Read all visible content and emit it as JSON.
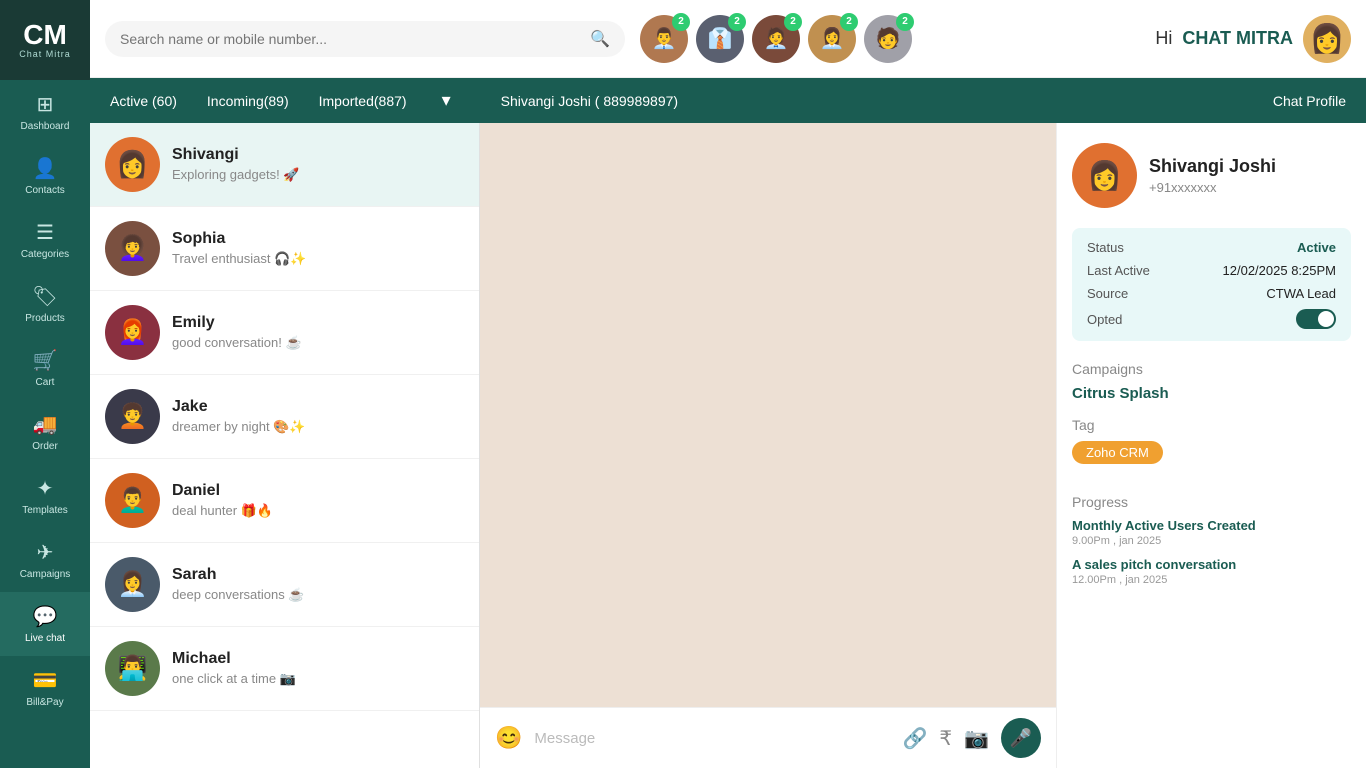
{
  "sidebar": {
    "logo": {
      "cm": "CM",
      "subtitle": "Chat Mitra"
    },
    "items": [
      {
        "id": "dashboard",
        "label": "Dashboard",
        "icon": "⊞"
      },
      {
        "id": "contacts",
        "label": "Contacts",
        "icon": "👤"
      },
      {
        "id": "categories",
        "label": "Categories",
        "icon": "≡"
      },
      {
        "id": "products",
        "label": "Products",
        "icon": "🏷"
      },
      {
        "id": "cart",
        "label": "Cart",
        "icon": "🛒"
      },
      {
        "id": "order",
        "label": "Order",
        "icon": "🚚"
      },
      {
        "id": "templates",
        "label": "Templates",
        "icon": "✦"
      },
      {
        "id": "campaigns",
        "label": "Campaigns",
        "icon": "✈"
      },
      {
        "id": "livechat",
        "label": "Live chat",
        "icon": "💬",
        "active": true
      },
      {
        "id": "billpay",
        "label": "Bill&Pay",
        "icon": "💳"
      }
    ]
  },
  "topbar": {
    "search_placeholder": "Search name or mobile number...",
    "greeting_hi": "Hi ",
    "greeting_brand": "CHAT MITRA",
    "avatars": [
      {
        "id": "av1",
        "badge": "2",
        "color": "#8B6550"
      },
      {
        "id": "av2",
        "badge": "2",
        "color": "#5a5a5a"
      },
      {
        "id": "av3",
        "badge": "2",
        "color": "#6a4a3a"
      },
      {
        "id": "av4",
        "badge": "2",
        "color": "#c08040"
      },
      {
        "id": "av5",
        "badge": "2",
        "color": "#a0a0a0"
      }
    ]
  },
  "subheader": {
    "tabs": [
      {
        "id": "active",
        "label": "Active (60)"
      },
      {
        "id": "incoming",
        "label": "Incoming(89)"
      },
      {
        "id": "imported",
        "label": "Imported(887)"
      }
    ],
    "contact": "Shivangi Joshi ( 889989897)",
    "chat_profile": "Chat Profile"
  },
  "chat_list": {
    "items": [
      {
        "id": "shivangi",
        "name": "Shivangi",
        "preview": "Exploring gadgets! 🚀",
        "active": true,
        "color": "#e07030"
      },
      {
        "id": "sophia",
        "name": "Sophia",
        "preview": "Travel enthusiast 🎧✨",
        "active": false,
        "color": "#7a5a40"
      },
      {
        "id": "emily",
        "name": "Emily",
        "preview": "good conversation! ☕",
        "active": false,
        "color": "#8a3040"
      },
      {
        "id": "jake",
        "name": "Jake",
        "preview": "dreamer by night 🎨✨",
        "active": false,
        "color": "#3a3a4a"
      },
      {
        "id": "daniel",
        "name": "Daniel",
        "preview": "deal hunter 🎁🔥",
        "active": false,
        "color": "#d06020"
      },
      {
        "id": "sarah",
        "name": "Sarah",
        "preview": "deep conversations ☕",
        "active": false,
        "color": "#4a5a6a"
      },
      {
        "id": "michael",
        "name": "Michael",
        "preview": "one click at a time 📷",
        "active": false,
        "color": "#5a7a4a"
      }
    ]
  },
  "message_input": {
    "placeholder": "Message",
    "emoji_icon": "😊",
    "attach_icon": "🔗",
    "rupee_icon": "₹",
    "camera_icon": "📷",
    "mic_icon": "🎤"
  },
  "right_panel": {
    "name": "Shivangi Joshi",
    "phone": "+91xxxxxxx",
    "status_label": "Status",
    "status_value": "Active",
    "last_active_label": "Last Active",
    "last_active_value": "12/02/2025 8:25PM",
    "source_label": "Source",
    "source_value": "CTWA Lead",
    "opted_label": "Opted",
    "campaigns_label": "Campaigns",
    "campaign_name": "Citrus Splash",
    "tag_label": "Tag",
    "tag_value": "Zoho CRM",
    "progress_label": "Progress",
    "progress_items": [
      {
        "id": "p1",
        "title": "Monthly Active Users Created",
        "date": "9.00Pm , jan 2025"
      },
      {
        "id": "p2",
        "title": "A sales pitch conversation",
        "date": "12.00Pm , jan 2025"
      }
    ]
  }
}
